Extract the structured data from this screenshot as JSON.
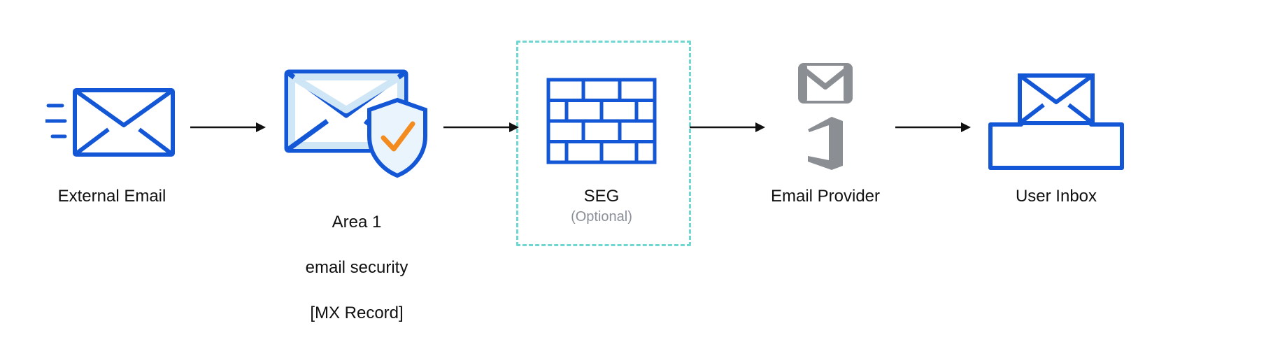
{
  "nodes": {
    "external_email": {
      "label": "External Email"
    },
    "area1": {
      "label_line1": "Area 1",
      "label_line2": "email security",
      "label_line3": "[MX Record]"
    },
    "seg": {
      "label": "SEG",
      "sublabel": "(Optional)"
    },
    "email_provider": {
      "label": "Email Provider"
    },
    "user_inbox": {
      "label": "User Inbox"
    }
  },
  "colors": {
    "blue": "#1457d6",
    "lightblue": "#cfe6f7",
    "orange": "#f38b1e",
    "gray": "#8b8e92",
    "dashed": "#6fd6d2",
    "black": "#111111"
  }
}
